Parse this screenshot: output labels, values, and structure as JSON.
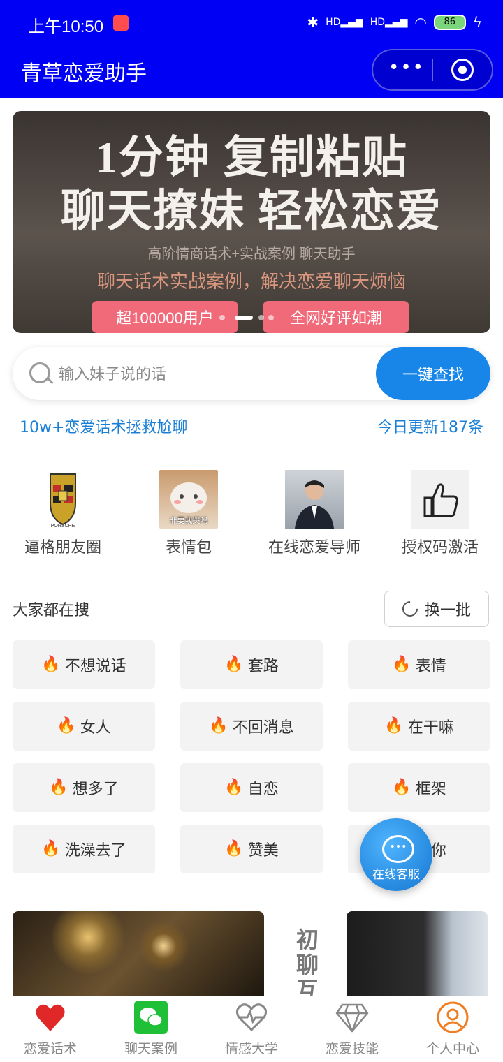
{
  "status": {
    "time": "上午10:50",
    "battery": "86",
    "signal1": "HD",
    "signal2": "HD"
  },
  "header": {
    "title": "青草恋爱助手",
    "menu_dots": "•••"
  },
  "banner": {
    "line1": "1分钟 复制粘贴",
    "line2": "聊天撩妹 轻松恋爱",
    "line3": "高阶情商话术+实战案例 聊天助手",
    "line4": "聊天话术实战案例，解决恋爱聊天烦恼",
    "pill1": "超100000用户",
    "pill2": "全网好评如潮"
  },
  "search": {
    "placeholder": "输入妹子说的话",
    "button": "一键查找"
  },
  "stats": {
    "left": "10w+恋爱话术拯救尬聊",
    "right": "今日更新187条"
  },
  "quick_links": [
    {
      "label": "逼格朋友圈",
      "icon": "porsche-logo-icon"
    },
    {
      "label": "表情包",
      "icon": "cat-meme-icon",
      "caption": "非要我哭吗"
    },
    {
      "label": "在线恋爱导师",
      "icon": "mentor-photo-icon"
    },
    {
      "label": "授权码激活",
      "icon": "thumbs-up-icon"
    }
  ],
  "popular": {
    "title": "大家都在搜",
    "refresh": "换一批",
    "tags": [
      {
        "text": "不想说话",
        "color": "#e0261f"
      },
      {
        "text": "套路",
        "color": "#e0261f"
      },
      {
        "text": "表情",
        "color": "#f28a1e"
      },
      {
        "text": "女人",
        "color": "#f28a1e"
      },
      {
        "text": "不回消息",
        "color": "#e0261f"
      },
      {
        "text": "在干嘛",
        "color": "#e0261f"
      },
      {
        "text": "想多了",
        "color": "#f28a1e"
      },
      {
        "text": "自恋",
        "color": "#e0261f"
      },
      {
        "text": "框架",
        "color": "#e0261f"
      },
      {
        "text": "洗澡去了",
        "color": "#f28a1e"
      },
      {
        "text": "赞美",
        "color": "#e0261f"
      },
      {
        "text": "理你",
        "color": "#e0261f"
      }
    ]
  },
  "service": {
    "label": "在线客服"
  },
  "feature_text": "初聊互",
  "tabbar": [
    {
      "label": "恋爱话术",
      "icon": "heart-icon"
    },
    {
      "label": "聊天案例",
      "icon": "wechat-icon"
    },
    {
      "label": "情感大学",
      "icon": "heartbeat-icon"
    },
    {
      "label": "恋爱技能",
      "icon": "diamond-icon"
    },
    {
      "label": "个人中心",
      "icon": "user-icon"
    }
  ]
}
